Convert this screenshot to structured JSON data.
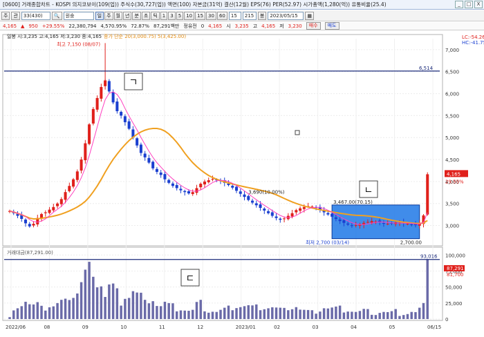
{
  "window": {
    "title": "[0600] 거래종합차트 - KOSPI 의지코보이(109(업)) 주식수(30,727(업)) 액면(100) 자본금(31억) 결산(12월) EPS(76) PER(52.97) 시가총액(1,280(억)) 유통비율(25.4)",
    "min_label": "_",
    "max_label": "□",
    "close_label": "X"
  },
  "toolbar": {
    "code_label": "주",
    "type_label": "관",
    "stock_code": "33(430)",
    "stock_name": "원숭",
    "period_buttons": [
      "일",
      "주",
      "월",
      "년",
      "분",
      "초",
      "틱",
      "1",
      "3",
      "5",
      "10",
      "15",
      "30",
      "60"
    ],
    "count_value": "15",
    "view_value": "215",
    "view_unit": "봉",
    "date_value": "2023/05/15"
  },
  "quote": {
    "price": "4,165",
    "change": "950",
    "change_pct": "+29.55%",
    "volume": "22,380,794",
    "prev_vol": "4,570.95%",
    "ratio": "72.87%",
    "amount": "87,291백만",
    "mkt_label": "정유전",
    "mkt_value": "0",
    "price2": "4,165",
    "open_label": "시",
    "open_value": "3,235",
    "high_label": "고",
    "high_value": "4,165",
    "low_label": "저",
    "low_value": "3,230",
    "buy_label": "매수",
    "sell_label": "매도"
  },
  "main_panel": {
    "legend": "일봉 시:3,235 고:4,165 저:3,230 종:4,165",
    "ma_legend": "종가 단순 20(3,000.75) 5(3,425.00)",
    "right_top": "LC:-54.26",
    "right_top2": "HC:-41.75",
    "max_annot": "최고 7,150 (08/07)",
    "min_annot": "최저 2,700 (03/14)",
    "box_top_annot": "3,467.00(70.15)",
    "box_bottom_annot": "2,700.00",
    "mid_annot": "3,690(10.00%)",
    "hline_value": "6,514",
    "price_label": "4,165",
    "pct_label": "29.55%",
    "letter_a": "ㄱ",
    "letter_b": "ㄴ"
  },
  "volume_panel": {
    "legend": "거래대금(87,291.00)",
    "hline_value": "93,016",
    "vol_label": "87,291",
    "vol_label2": "81,700",
    "letter_c": "ㄷ",
    "axis_labels": [
      "100,000",
      "75,000",
      "50,000",
      "25,000",
      "0"
    ]
  },
  "x_axis_labels": [
    "2022/06",
    "08",
    "09",
    "10",
    "11",
    "12",
    "2023/01",
    "02",
    "03",
    "04",
    "05",
    "06/15"
  ],
  "colors": {
    "up": "#e0201b",
    "down": "#1a3fd0",
    "ma20": "#f0a020",
    "ma5": "#ff40c0",
    "box_fill": "#1e78e6",
    "hline": "#1a2a7a",
    "volume": "#6a6aa8"
  },
  "chart_data": {
    "type": "candlestick",
    "price_axis": {
      "min": 2700,
      "max": 7150,
      "ticks": [
        3000,
        3500,
        4000,
        4500,
        5000,
        5500,
        6000,
        6500,
        7000
      ]
    },
    "closes": [
      3330,
      3280,
      3220,
      3150,
      3050,
      2980,
      3040,
      3170,
      3260,
      3300,
      3360,
      3420,
      3500,
      3600,
      3760,
      3900,
      4050,
      4230,
      4500,
      4870,
      5300,
      5650,
      5900,
      6150,
      6300,
      6050,
      5800,
      5600,
      5500,
      5350,
      5200,
      5000,
      4820,
      4650,
      4550,
      4430,
      4300,
      4220,
      4150,
      4050,
      3970,
      3900,
      3850,
      3800,
      3760,
      3730,
      3760,
      3850,
      3950,
      4000,
      4030,
      4060,
      4040,
      4010,
      3970,
      3920,
      3860,
      3790,
      3720,
      3650,
      3580,
      3520,
      3460,
      3400,
      3340,
      3280,
      3220,
      3170,
      3130,
      3160,
      3220,
      3280,
      3350,
      3390,
      3420,
      3440,
      3430,
      3400,
      3360,
      3300,
      3250,
      3200,
      3150,
      3100,
      3060,
      3020,
      2990,
      3010,
      3030,
      3060,
      3080,
      3100,
      3090,
      3070,
      3050,
      3040,
      3050,
      3070,
      3060,
      3050,
      3040,
      3020,
      3010,
      3050,
      3230,
      4165
    ],
    "volume_axis": {
      "min": 0,
      "max": 100000,
      "ticks": [
        0,
        25000,
        50000,
        75000,
        100000
      ]
    },
    "volume_hline": 93016
  }
}
